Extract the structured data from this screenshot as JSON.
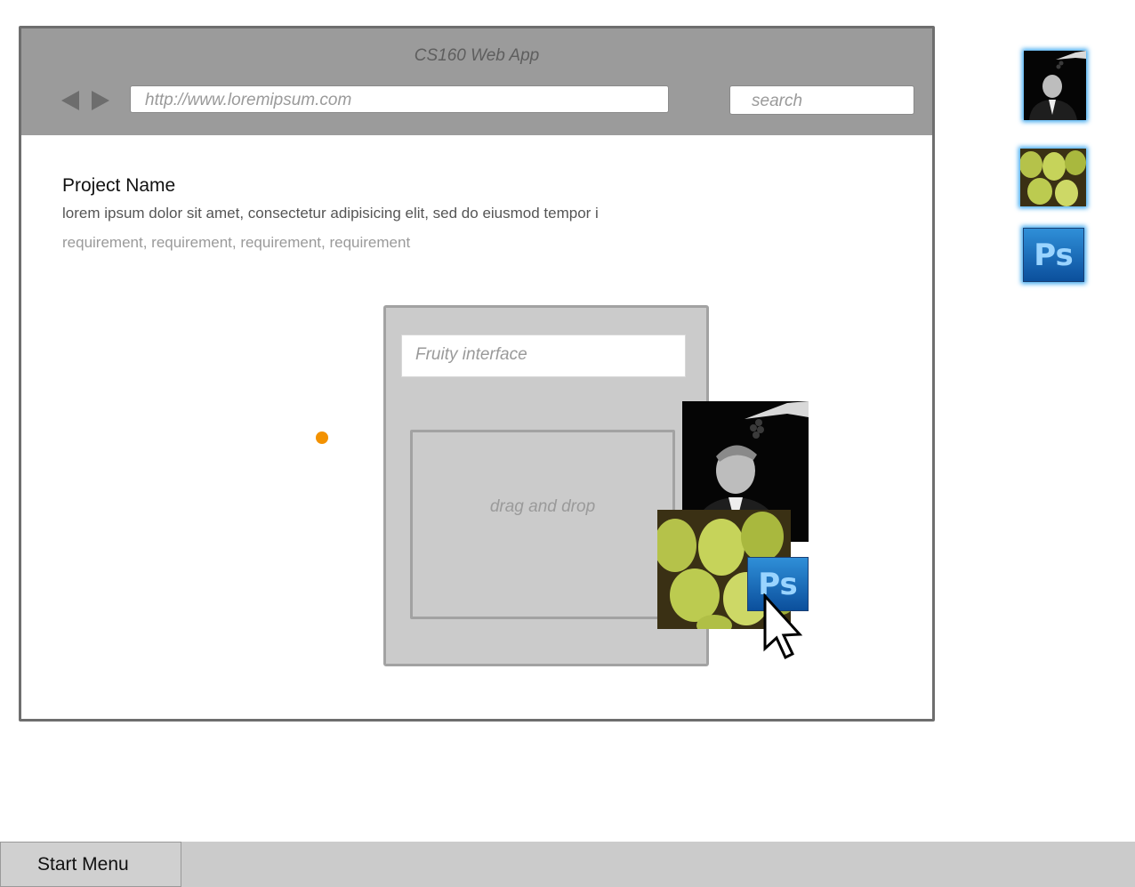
{
  "browser": {
    "title": "CS160 Web App",
    "url": "http://www.loremipsum.com",
    "search_placeholder": "search"
  },
  "content": {
    "project_name": "Project Name",
    "description": "lorem ipsum dolor sit amet, consectetur adipisicing elit, sed do eiusmod tempor i",
    "requirements": "requirement, requirement, requirement, requirement"
  },
  "panel": {
    "input_placeholder": "Fruity interface",
    "drop_label": "drag and drop"
  },
  "images": {
    "photoshop_label": "Ps"
  },
  "taskbar": {
    "start_label": "Start Menu"
  },
  "colors": {
    "accent_dot": "#f39200",
    "thumbnail_glow": "#3aa6ee"
  }
}
